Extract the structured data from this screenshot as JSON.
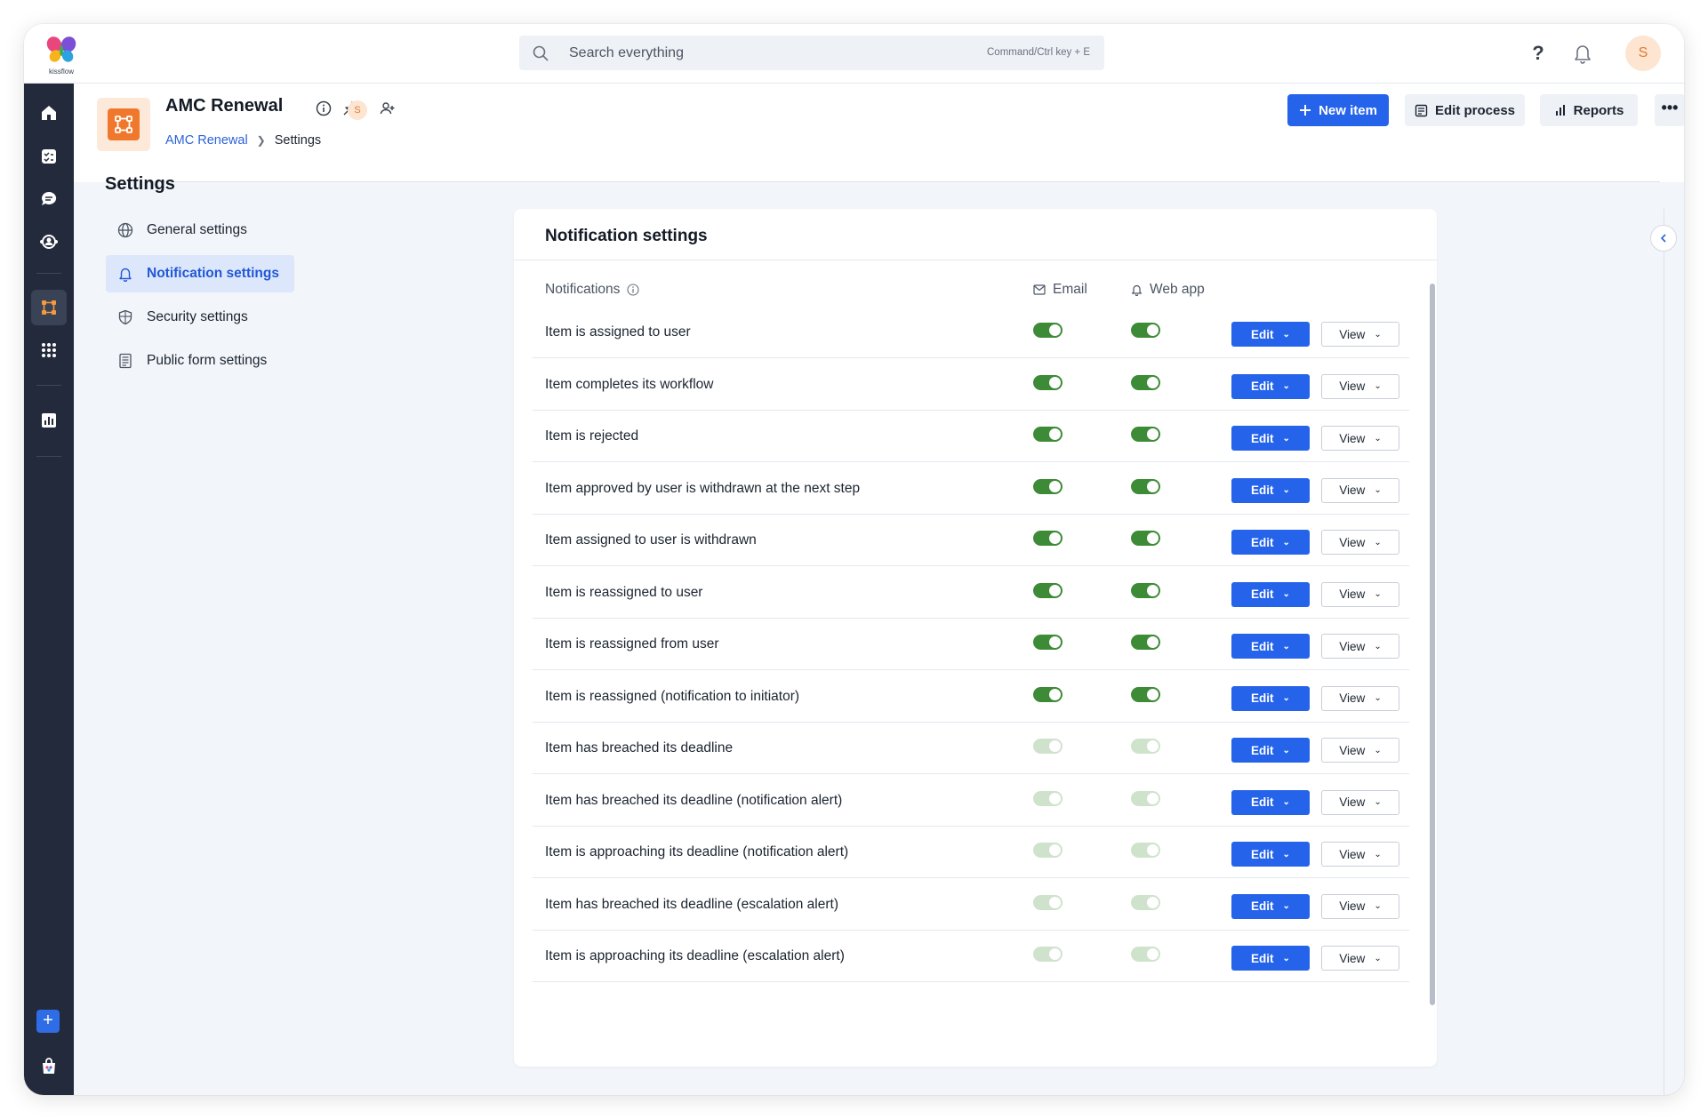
{
  "brand": {
    "logo_text": "kissflow"
  },
  "topbar": {
    "search_placeholder": "Search everything",
    "search_shortcut": "Command/Ctrl key + E",
    "help_label": "?",
    "avatar_initial": "S"
  },
  "header": {
    "app_title": "AMC Renewal",
    "owner_initial": "S",
    "breadcrumb": {
      "link": "AMC Renewal",
      "current": "Settings"
    },
    "new_item_label": "New item",
    "edit_process_label": "Edit process",
    "reports_label": "Reports",
    "more_label": "•••"
  },
  "settings": {
    "title": "Settings",
    "nav": [
      {
        "label": "General settings",
        "icon": "globe-icon"
      },
      {
        "label": "Notification settings",
        "icon": "bell-icon",
        "active": true
      },
      {
        "label": "Security settings",
        "icon": "shield-icon"
      },
      {
        "label": "Public form settings",
        "icon": "form-icon"
      }
    ]
  },
  "notifications": {
    "title": "Notification settings",
    "col_notifications": "Notifications",
    "col_email": "Email",
    "col_webapp": "Web app",
    "edit_label": "Edit",
    "view_label": "View",
    "rows": [
      {
        "label": "Item is assigned to user",
        "email": true,
        "webapp": true
      },
      {
        "label": "Item completes its workflow",
        "email": true,
        "webapp": true
      },
      {
        "label": "Item is rejected",
        "email": true,
        "webapp": true
      },
      {
        "label": "Item approved by user is withdrawn at the next step",
        "email": true,
        "webapp": true
      },
      {
        "label": "Item assigned to user is withdrawn",
        "email": true,
        "webapp": true
      },
      {
        "label": "Item is reassigned to user",
        "email": true,
        "webapp": true
      },
      {
        "label": "Item is reassigned from user",
        "email": true,
        "webapp": true
      },
      {
        "label": "Item is reassigned (notification to initiator)",
        "email": true,
        "webapp": true
      },
      {
        "label": "Item has breached its deadline",
        "email": false,
        "webapp": false
      },
      {
        "label": "Item has breached its deadline (notification alert)",
        "email": false,
        "webapp": false
      },
      {
        "label": "Item is approaching its deadline (notification alert)",
        "email": false,
        "webapp": false
      },
      {
        "label": "Item has breached its deadline (escalation alert)",
        "email": false,
        "webapp": false
      },
      {
        "label": "Item is approaching its deadline (escalation alert)",
        "email": false,
        "webapp": false
      }
    ]
  },
  "colors": {
    "primary": "#2563eb",
    "sidebar": "#232a3b",
    "toggle_on": "#3d8b37",
    "toggle_off": "#cfe3cc",
    "accent_orange": "#f0782c"
  }
}
